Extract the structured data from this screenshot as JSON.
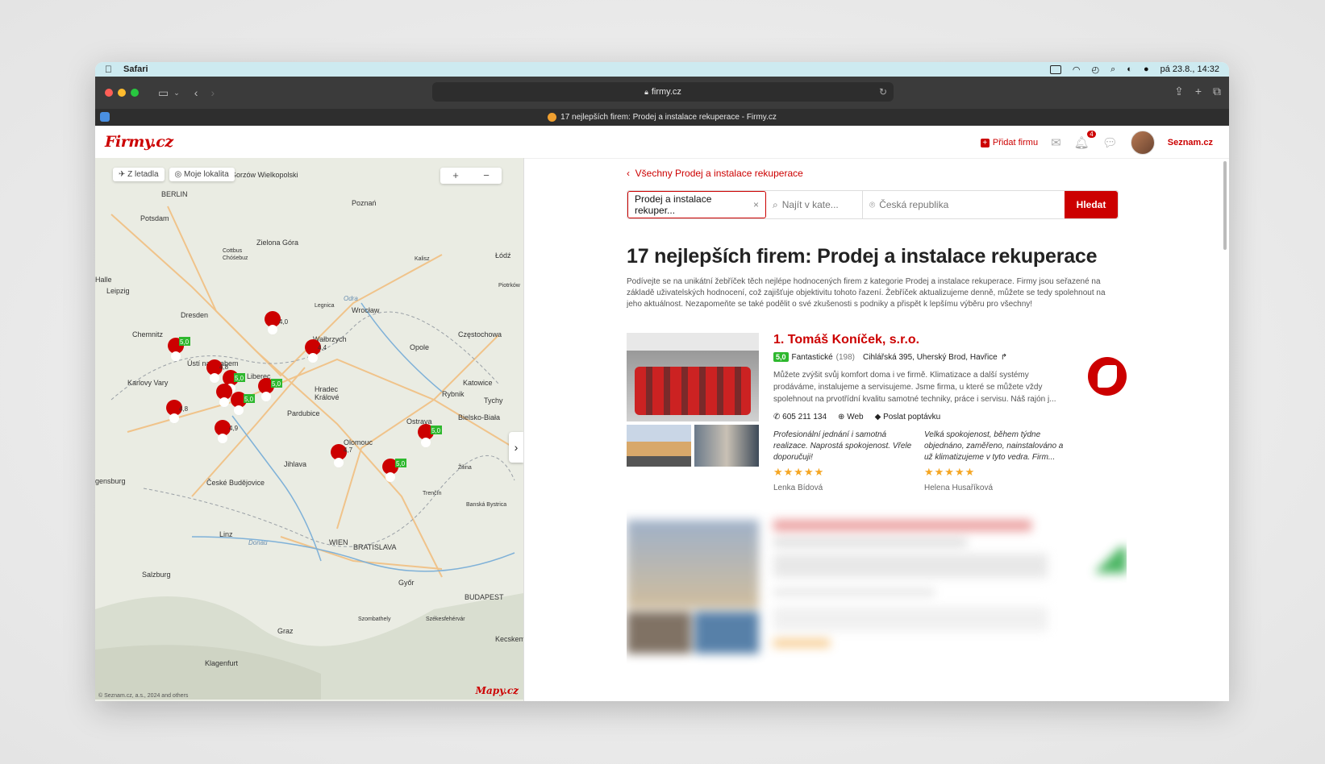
{
  "macos": {
    "app": "Safari",
    "clock": "pá 23.8., 14:32"
  },
  "browser": {
    "url": "firmy.cz",
    "tab_title": "17 nejlepších firem: Prodej a instalace rekuperace - Firmy.cz"
  },
  "header": {
    "logo": "Firmy.cz",
    "add_firm": "Přidat firmu",
    "notif_count": "4",
    "account": "Seznam.cz"
  },
  "map": {
    "btn_plane": "Z letadla",
    "btn_location": "Moje lokalita",
    "zoom_in": "+",
    "zoom_out": "−",
    "brand": "Mapy.cz",
    "copyright": "© Seznam.cz, a.s., 2024 and others",
    "cities": [
      "Berlin",
      "Poznań",
      "Potsdam",
      "Gorzów Wielkopolski",
      "Zielona Góra",
      "Cottbus",
      "Chóśebuz",
      "Łódź",
      "Kalisz",
      "Piotrków",
      "Halle",
      "Leipzig",
      "Dresden",
      "Wrocław",
      "Legnica",
      "Odra",
      "Chemnitz",
      "Wałbrzych",
      "Częstochowa",
      "Opole",
      "Ústí nad Labem",
      "Liberec",
      "Hradec Králové",
      "Katowice",
      "Karlovy Vary",
      "Pardubice",
      "Rybnik",
      "Tychy",
      "Bielsko-Biała",
      "Ostrava",
      "Olomouc",
      "Jihlava",
      "Žilina",
      "České Budějovice",
      "Regensburg",
      "Trenčín",
      "Banská Bystrica",
      "Linz",
      "Donau",
      "Wien",
      "Bratislava",
      "Salzburg",
      "Győr",
      "Budapest",
      "Szombathely",
      "Graz",
      "Székesfehérvár",
      "Klagenfurt",
      "Kecskemét"
    ],
    "ratings": [
      "4,0",
      "5,0",
      "4,4",
      "4,8",
      "5,0",
      "5,0",
      "5,0",
      "4,9",
      "4,7",
      "5,0",
      "5,0",
      "4,6"
    ]
  },
  "content": {
    "back_link": "Všechny Prodej a instalace rekuperace",
    "search_what": "Prodej a instalace rekuper...",
    "search_category_placeholder": "Najít v kate...",
    "search_where_placeholder": "Česká republika",
    "search_button": "Hledat",
    "title": "17 nejlepších firem: Prodej a instalace rekuperace",
    "intro": "Podívejte se na unikátní žebříček těch nejlépe hodnocených firem z kategorie Prodej a instalace rekuperace. Firmy jsou seřazené na základě uživatelských hodnocení, což zajišťuje objektivitu tohoto řazení. Žebříček aktualizujeme denně, můžete se tedy spolehnout na jeho aktuálnost. Nezapomeňte se také podělit o své zkušenosti s podniky a přispět k lepšímu výběru pro všechny!"
  },
  "firm": {
    "name": "1. Tomáš Koníček, s.r.o.",
    "score": "5,0",
    "rating_label": "Fantastické",
    "rating_count": "(198)",
    "address": "Cihlářská 395, Uherský Brod, Havřice",
    "description": "Můžete zvýšit svůj komfort doma i ve firmě. Klimatizace a další systémy prodáváme, instalujeme a servisujeme. Jsme firma, u které se můžete vždy spolehnout na prvotřídní kvalitu samotné techniky, práce i servisu. Náš rajón j...",
    "phone": "605 211 134",
    "web": "Web",
    "inquiry": "Poslat poptávku",
    "reviews": [
      {
        "text": "Profesionální jednání i samotná realizace. Naprostá spokojenost. Vřele doporučuji!",
        "stars": "★★★★★",
        "author": "Lenka Bídová"
      },
      {
        "text": "Velká spokojenost, během týdne objednáno, zaměřeno, nainstalováno a už klimatizujeme v tyto vedra. Firm...",
        "stars": "★★★★★",
        "author": "Helena Husaříková"
      }
    ]
  },
  "colors": {
    "brand_red": "#cc0000",
    "score_green": "#2eb82e",
    "star": "#f5a623"
  }
}
